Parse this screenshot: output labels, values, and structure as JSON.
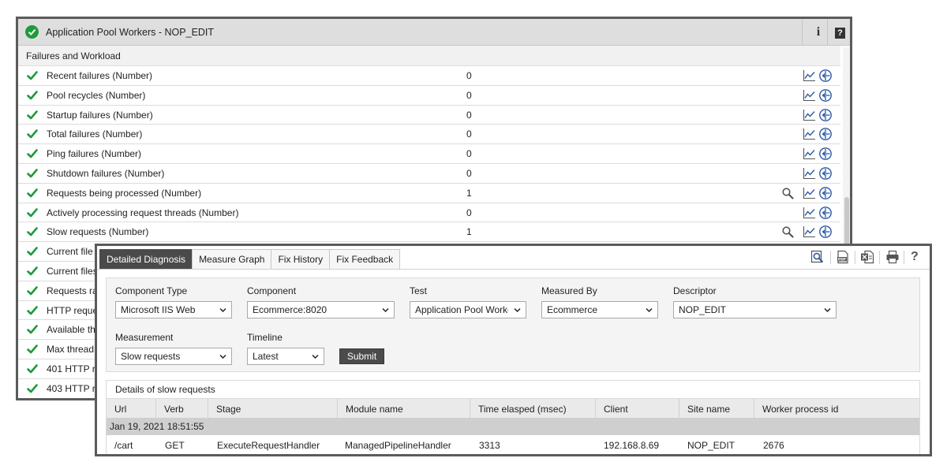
{
  "back_panel": {
    "title": "Application Pool Workers - NOP_EDIT",
    "info_label": "i",
    "help_label": "?",
    "section_title": "Failures and Workload",
    "rows": [
      {
        "label": "Recent failures (Number)",
        "value": "0",
        "zoom": false
      },
      {
        "label": "Pool recycles (Number)",
        "value": "0",
        "zoom": false
      },
      {
        "label": "Startup failures (Number)",
        "value": "0",
        "zoom": false
      },
      {
        "label": "Total failures (Number)",
        "value": "0",
        "zoom": false
      },
      {
        "label": "Ping failures (Number)",
        "value": "0",
        "zoom": false
      },
      {
        "label": "Shutdown failures (Number)",
        "value": "0",
        "zoom": false
      },
      {
        "label": "Requests being processed (Number)",
        "value": "1",
        "zoom": true
      },
      {
        "label": "Actively processing request threads (Number)",
        "value": "0",
        "zoom": false
      },
      {
        "label": "Slow requests (Number)",
        "value": "1",
        "zoom": true
      },
      {
        "label": "Current file",
        "value": "",
        "zoom": false
      },
      {
        "label": "Current files",
        "value": "",
        "zoom": false
      },
      {
        "label": "Requests ra",
        "value": "",
        "zoom": false
      },
      {
        "label": "HTTP reque",
        "value": "",
        "zoom": false
      },
      {
        "label": "Available th",
        "value": "",
        "zoom": false
      },
      {
        "label": "Max thread",
        "value": "",
        "zoom": false
      },
      {
        "label": "401 HTTP r",
        "value": "",
        "zoom": false
      },
      {
        "label": "403 HTTP r",
        "value": "",
        "zoom": false
      }
    ]
  },
  "front_panel": {
    "tabs": [
      {
        "label": "Detailed Diagnosis",
        "active": true
      },
      {
        "label": "Measure Graph",
        "active": false
      },
      {
        "label": "Fix History",
        "active": false
      },
      {
        "label": "Fix Feedback",
        "active": false
      }
    ],
    "toolbar_icons": [
      "zoom-report-icon",
      "pdf-icon",
      "excel-icon",
      "print-icon",
      "help-icon"
    ],
    "help_label": "?",
    "form": {
      "component_type": {
        "label": "Component Type",
        "value": "Microsoft IIS Web"
      },
      "component": {
        "label": "Component",
        "value": "Ecommerce:8020"
      },
      "test": {
        "label": "Test",
        "value": "Application Pool Worker"
      },
      "measured_by": {
        "label": "Measured By",
        "value": "Ecommerce"
      },
      "descriptor": {
        "label": "Descriptor",
        "value": "NOP_EDIT"
      },
      "measurement": {
        "label": "Measurement",
        "value": "Slow requests"
      },
      "timeline": {
        "label": "Timeline",
        "value": "Latest"
      },
      "submit_label": "Submit"
    },
    "details": {
      "title": "Details of slow requests",
      "columns": [
        "Url",
        "Verb",
        "Stage",
        "Module name",
        "Time elasped (msec)",
        "Client",
        "Site name",
        "Worker process id"
      ],
      "group_label": "Jan 19, 2021 18:51:55",
      "rows": [
        [
          "/cart",
          "GET",
          "ExecuteRequestHandler",
          "ManagedPipelineHandler",
          "3313",
          "192.168.8.69",
          "NOP_EDIT",
          "2676"
        ]
      ]
    }
  },
  "colors": {
    "ok_green": "#1f9a3c",
    "active_tab": "#4a4a4a",
    "frame_border": "#5b5b5b",
    "icon_blue": "#2d5aa6"
  }
}
